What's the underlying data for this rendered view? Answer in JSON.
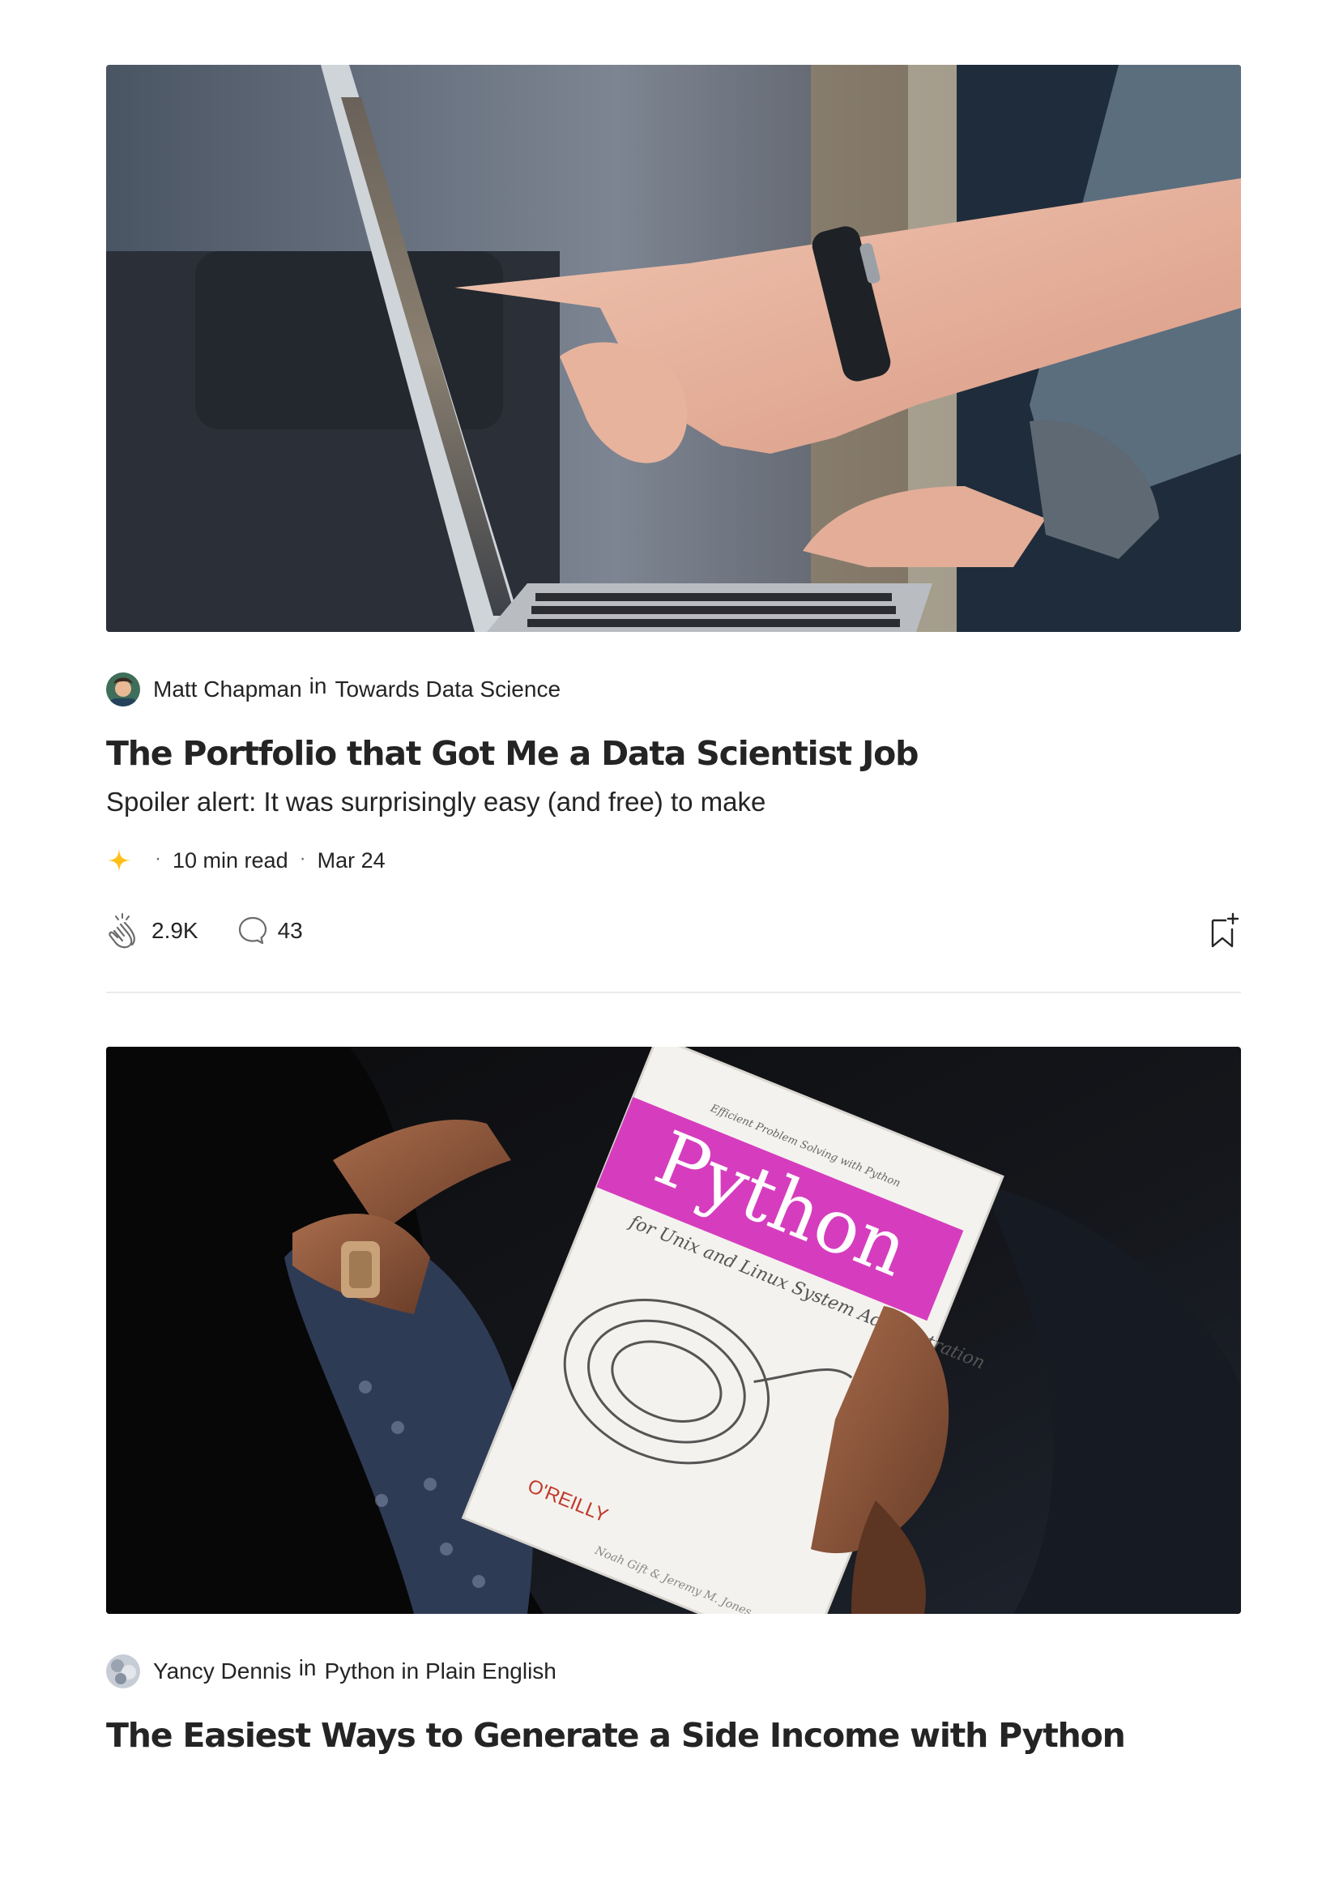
{
  "articles": [
    {
      "author": "Matt Chapman",
      "in_word": "in",
      "publication": "Towards Data Science",
      "title": "The Portfolio that Got Me a Data Scientist Job",
      "subtitle": "Spoiler alert: It was surprisingly easy (and free) to make",
      "member_icon": "sparkle-star-icon",
      "member_icon_color": "#FFC017",
      "read_time": "10 min read",
      "date": "Mar 24",
      "separator": "·",
      "claps": "2.9K",
      "comments": "43"
    },
    {
      "author": "Yancy Dennis",
      "in_word": "in",
      "publication": "Python in Plain English",
      "title": "The Easiest Ways to Generate a Side Income with Python"
    }
  ],
  "book_cover": {
    "title": "Python",
    "tagline": "for Unix and Linux System Administration",
    "top_text": "Efficient Problem Solving with Python",
    "publisher": "O'REILLY",
    "authors": "Noah Gift & Jeremy M. Jones",
    "accent_color": "#D63DBE"
  },
  "colors": {
    "text": "#242424",
    "muted": "#6B6B6B",
    "divider": "#EBEBEB"
  }
}
